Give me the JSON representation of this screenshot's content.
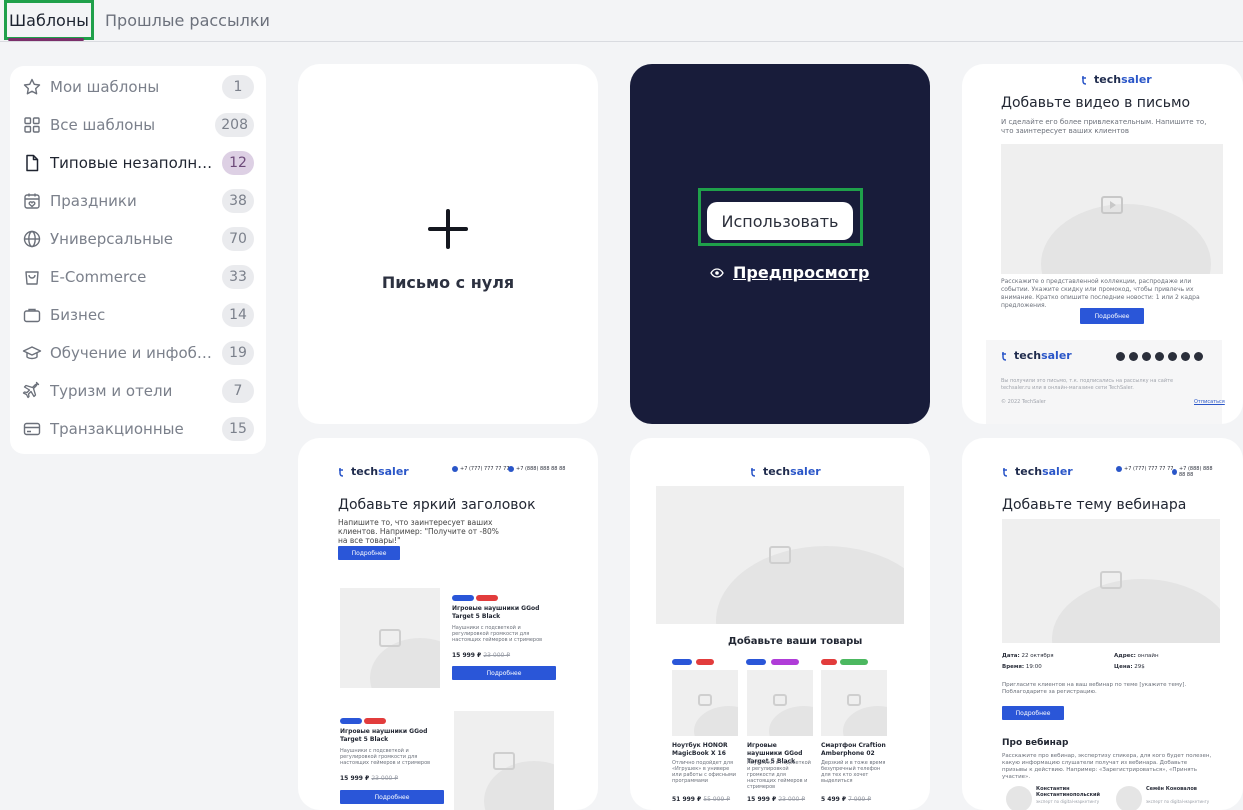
{
  "tabs": {
    "templates": "Шаблоны",
    "past": "Прошлые рассылки"
  },
  "sidebar": {
    "items": [
      {
        "label": "Мои шаблоны",
        "count": "1",
        "icon": "star-icon"
      },
      {
        "label": "Все шаблоны",
        "count": "208",
        "icon": "grid-icon"
      },
      {
        "label": "Типовые незаполненные",
        "count": "12",
        "icon": "document-icon"
      },
      {
        "label": "Праздники",
        "count": "38",
        "icon": "calendar-icon"
      },
      {
        "label": "Универсальные",
        "count": "70",
        "icon": "globe-icon"
      },
      {
        "label": "E-Commerce",
        "count": "33",
        "icon": "shopping-bag-icon"
      },
      {
        "label": "Бизнес",
        "count": "14",
        "icon": "briefcase-icon"
      },
      {
        "label": "Обучение и инфобизнес",
        "count": "19",
        "icon": "graduation-cap-icon"
      },
      {
        "label": "Туризм и отели",
        "count": "7",
        "icon": "airplane-icon"
      },
      {
        "label": "Транзакционные",
        "count": "15",
        "icon": "credit-card-icon"
      }
    ]
  },
  "cards": {
    "new_label": "Письмо с нуля",
    "use_label": "Использовать",
    "preview_label": "Предпросмотр"
  },
  "brand": {
    "a": "tech",
    "b": "saler"
  },
  "tpl_video": {
    "title": "Добавьте видео в письмо",
    "text": "И сделайте его более привлекательным. Напишите то, что заинтересует ваших клиентов",
    "body": "Расскажите о представленной коллекции, распродаже или событии. Укажите скидку или промокод, чтобы привлечь их внимание. Кратко опишите последние новости: 1 или 2 кадра предложения.",
    "button": "Подробнее",
    "footer_text": "Вы получили это письмо, т.к. подписались на рассылку на сайте techsaler.ru или в онлайн-магазине сети TechSaler.",
    "copyright": "© 2022 TechSaler",
    "unsubscribe": "Отписаться"
  },
  "tpl_headline": {
    "phone1": "+7 (777) 777 77 77",
    "phone2": "+7 (888) 888 88 88",
    "title": "Добавьте яркий заголовок",
    "text": "Напишите то, что заинтересует ваших клиентов. Например: \"Получите от -80% на все товары!\"",
    "button": "Подробнее",
    "product1_name": "Игровые наушники GGod Target 5 Black",
    "product1_desc": "Наушники с подсветкой и регулировкой громкости для настоящих геймеров и стримеров",
    "product1_price": "15 999 ₽",
    "product1_old": "23 000 ₽",
    "product1_btn": "Подробнее",
    "product2_name": "Игровые наушники GGod Target 5 Black",
    "product2_desc": "Наушники с подсветкой и регулировкой громкости для настоящих геймеров и стримеров",
    "product2_price": "15 999 ₽",
    "product2_old": "23 000 ₽",
    "product2_btn": "Подробнее"
  },
  "tpl_products": {
    "title": "Добавьте ваши товары",
    "p1_name": "Ноутбук HONOR MagicBook X 16",
    "p1_desc": "Отлично подойдет для «Игрушек» в универе или работы с офисными программами",
    "p1_price": "51 999 ₽",
    "p1_old": "55 999 ₽",
    "p2_name": "Игровые наушники GGod Target 5 Black",
    "p2_desc": "Наушники с подсветкой и регулировкой громкости для настоящих геймеров и стримеров",
    "p2_price": "15 999 ₽",
    "p2_old": "23 000 ₽",
    "p3_name": "Смартфон Craftion Amberphone 02",
    "p3_desc": "Дерзкий и в тоже время безупречный телефон для тех кто хочет выделиться",
    "p3_price": "5 499 ₽",
    "p3_old": "7 999 ₽"
  },
  "tpl_webinar": {
    "phone1": "+7 (777) 777 77 77",
    "phone2": "+7 (888) 888 88 88",
    "title": "Добавьте тему вебинара",
    "date_label": "Дата:",
    "date_value": "22 октября",
    "address_label": "Адрес:",
    "address_value": "онлайн",
    "time_label": "Время:",
    "time_value": "19:00",
    "price_label": "Цена:",
    "price_value": "29$",
    "invite": "Пригласите клиентов на ваш вебинар по теме [укажите тему]. Поблагодарите за регистрацию.",
    "button": "Подробнее",
    "about_title": "Про вебинар",
    "about_text": "Расскажите про вебинар, экспертизу спикера, для кого будет полезен, какую информацию слушатели получат из вебинара. Добавьте призывы к действию. Например: «Зарегистрироваться», «Принять участие».",
    "speaker1": "Константин Константинопольский",
    "speaker1_role": "эксперт по digital-маркетингу",
    "speaker2": "Семён Коновалов",
    "speaker2_role": "эксперт по digital-маркетингу"
  },
  "colors": {
    "accent_green": "#1fa04a",
    "dark_card": "#181c3a",
    "active_badge": "#ddd0e4",
    "button_blue": "#2a56d8"
  }
}
